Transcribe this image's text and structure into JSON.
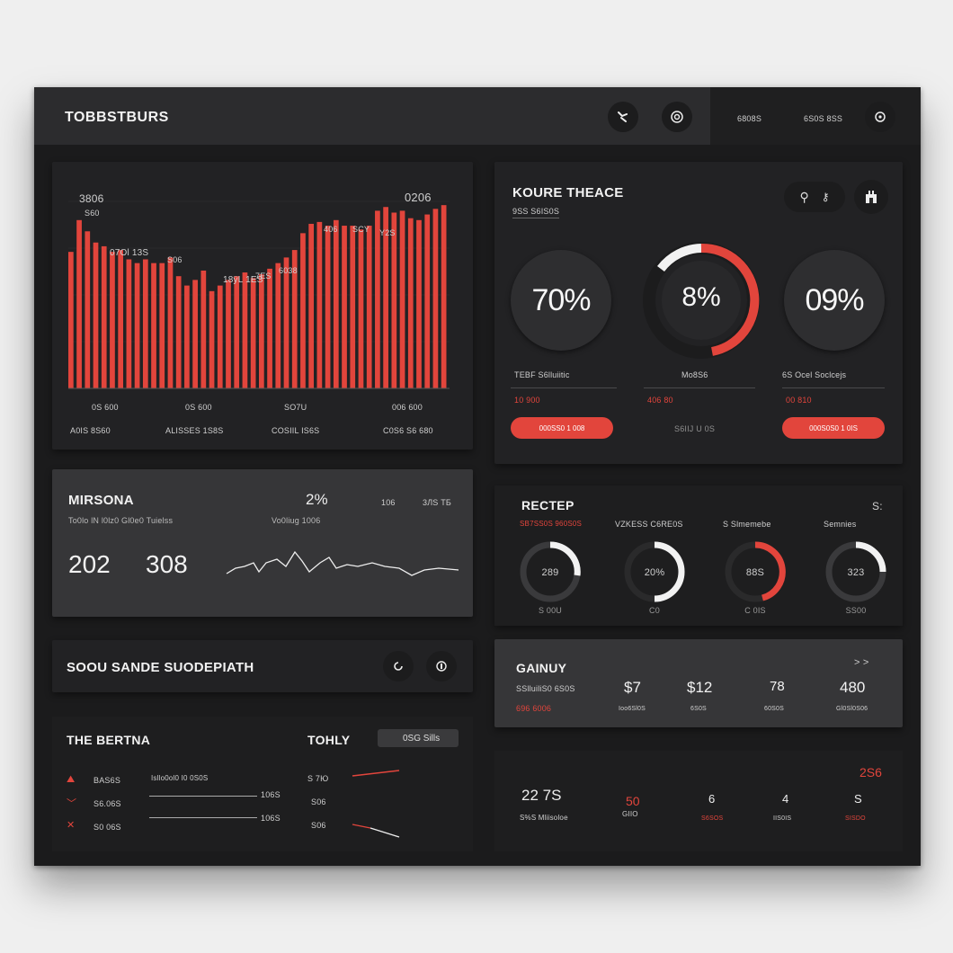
{
  "header": {
    "title": "TOBBSTBURS",
    "right_label_1": "6808S",
    "right_label_2": "6S0S 8SS"
  },
  "bar_panel": {
    "top_labels": [
      "3806",
      "S60",
      "07Ol 13S",
      "S06",
      "18ÿL 1ES",
      "7ES",
      "6038",
      "406",
      "SCY",
      "Y2S",
      "0206"
    ],
    "x_labels": [
      "0S 600",
      "0S 600",
      "SO7U",
      "006 600"
    ],
    "x_sublabels": [
      "A0IS 8S60",
      "ALISSES 1S8S",
      "COSIIL IS6S",
      "C0S6 S6 680"
    ]
  },
  "chart_data": {
    "type": "bar",
    "values": [
      73,
      90,
      84,
      78,
      76,
      73,
      74,
      69,
      67,
      69,
      67,
      67,
      70,
      60,
      55,
      58,
      63,
      52,
      55,
      58,
      60,
      62,
      59,
      61,
      64,
      67,
      70,
      74,
      83,
      88,
      89,
      87,
      90,
      87,
      87,
      85,
      87,
      95,
      97,
      94,
      95,
      91,
      90,
      93,
      96,
      98
    ],
    "color": "#e2453c",
    "ylim": [
      0,
      100
    ]
  },
  "gauge_panel": {
    "title": "KOURE THEACE",
    "subtitle": "9SS S6IS0S",
    "rings": [
      {
        "value": "70%",
        "caption": "TEBF S6lluiitic",
        "stat": "10 900",
        "button": "000SS0 1 008",
        "progress": 0
      },
      {
        "value": "8%",
        "caption": "Mo8S6",
        "stat": "406 80",
        "button": "S6IIJ U 0S",
        "progress": 0.55
      },
      {
        "value": "09%",
        "caption": "6S Ocel Soclcejs",
        "stat": "00 810",
        "button": "000S0S0 1 0IS",
        "progress": 0
      }
    ]
  },
  "line_panel": {
    "title": "MIRSONA",
    "subtitle": "To0lo lN l0lz0 Gl0e0 Tuielss",
    "percent": "2%",
    "percent_sub": "Vo0liug 1006",
    "tags": [
      "106",
      "3ЛS ТБ"
    ],
    "value_1": "202",
    "value_2": "308"
  },
  "section_bar": {
    "title": "SOOU SANDE SUODEPIATH"
  },
  "list_panel": {
    "title": "THE BERTNA",
    "right_title": "TOHLY",
    "pill": "0SG Sills",
    "rows": [
      {
        "label": "BAS6S",
        "desc": "Isllo0ol0 I0 0S0S",
        "value": "",
        "side": "S 7Ю"
      },
      {
        "label": "S6.06S",
        "desc": "",
        "value": "106S",
        "side": "S06"
      },
      {
        "label": "S0 06S",
        "desc": "",
        "value": "106S",
        "side": "S06"
      }
    ]
  },
  "donut_panel": {
    "title": "RECTEP",
    "corner": "S:",
    "items": [
      {
        "header": "SB7SS0S 960S0S",
        "value": "289",
        "footer": "S 00U"
      },
      {
        "header": "VZKESS C6RE0S",
        "value": "20%",
        "footer": "C0"
      },
      {
        "header": "S Slmemebe",
        "value": "88S",
        "footer": "C 0IS"
      },
      {
        "header": "Semnies",
        "value": "323",
        "footer": "SS00"
      }
    ]
  },
  "stats_panel": {
    "title": "GAINUY",
    "subtitle": "SSlluiliS0 6S0S",
    "subtitle_red": "696 6006",
    "nav": "> >",
    "stats": [
      {
        "value": "$7",
        "label": "Ioo6Sl0S"
      },
      {
        "value": "$12",
        "label": "6S0S"
      },
      {
        "value": "78",
        "label": "60S0S"
      },
      {
        "value": "480",
        "label": "Gl0Sl0S06"
      }
    ]
  },
  "bottom_panel": {
    "corner": "2S6",
    "main_value": "22 7S",
    "main_label": "S%S Mliisoloe",
    "stats": [
      {
        "value": "50",
        "label": "GIIO"
      },
      {
        "value": "6",
        "label": "S6SOS"
      },
      {
        "value": "4",
        "label": "IIS0IS"
      },
      {
        "value": "S",
        "label": "SISDO"
      }
    ]
  }
}
